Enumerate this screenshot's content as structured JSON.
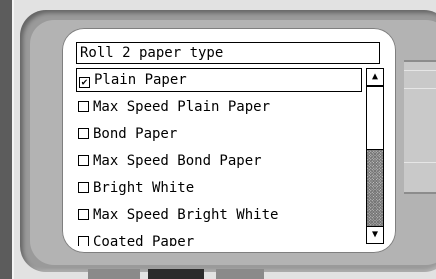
{
  "screen": {
    "title": "Roll 2 paper type"
  },
  "paper_types": {
    "items": [
      {
        "label": "Plain Paper",
        "checked": true,
        "check_mark": "✔"
      },
      {
        "label": "Max Speed Plain Paper",
        "checked": false,
        "check_mark": ""
      },
      {
        "label": "Bond Paper",
        "checked": false,
        "check_mark": ""
      },
      {
        "label": "Max Speed Bond Paper",
        "checked": false,
        "check_mark": ""
      },
      {
        "label": "Bright White",
        "checked": false,
        "check_mark": ""
      },
      {
        "label": "Max Speed Bright White",
        "checked": false,
        "check_mark": ""
      },
      {
        "label": "Coated Paper",
        "checked": false,
        "check_mark": ""
      }
    ],
    "selected_index": 0
  },
  "scrollbar": {
    "up_arrow": "▲",
    "down_arrow": "▼",
    "position_fraction": 0.0
  },
  "colors": {
    "screen_bg": "#ffffff",
    "text": "#000000",
    "bezel_dark": "#9a9a9a",
    "bottom_buttons": [
      "#8a8a8a",
      "#2b2b2b",
      "#8a8a8a"
    ]
  }
}
